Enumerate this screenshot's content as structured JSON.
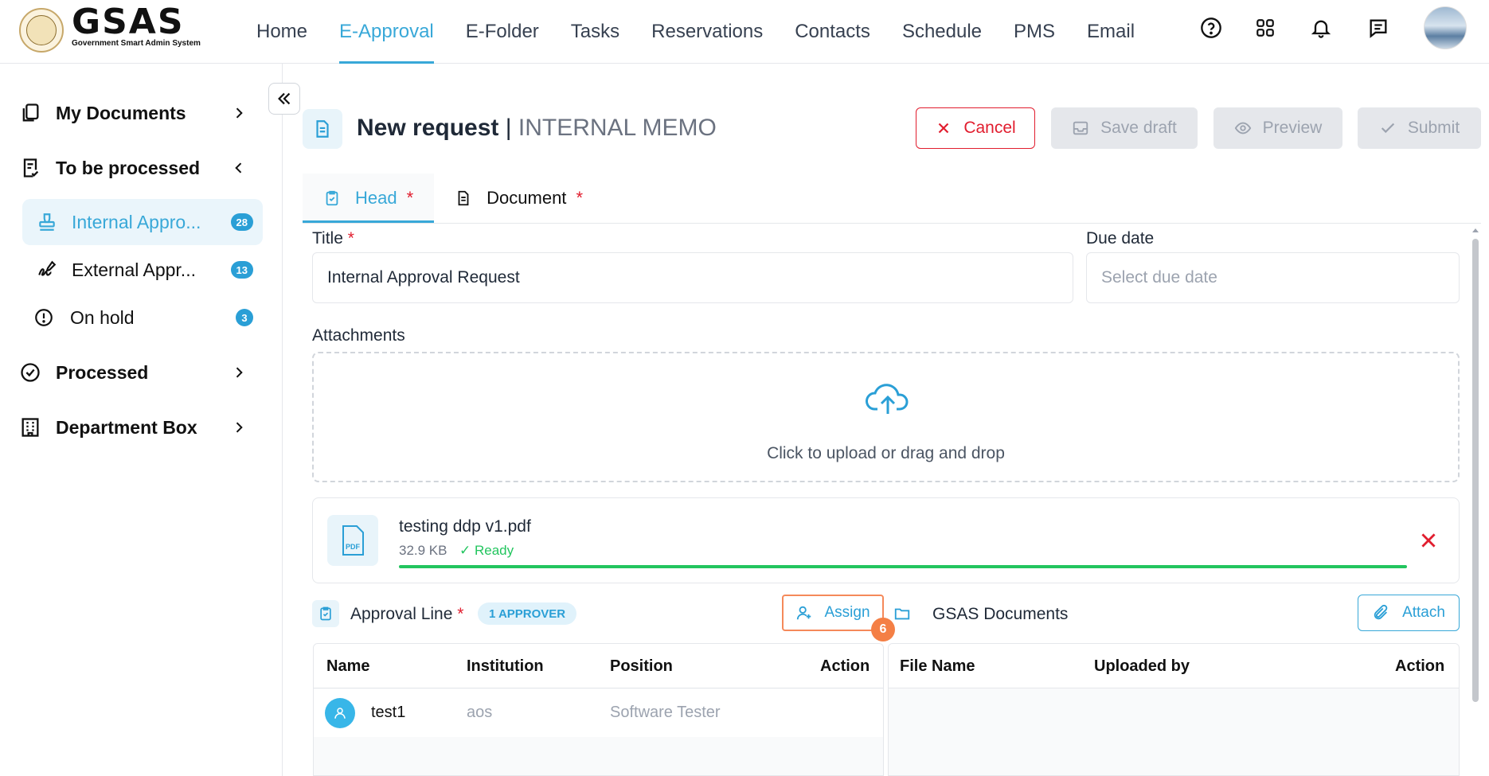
{
  "brand": {
    "name": "GSAS",
    "subtitle": "Government Smart Admin System"
  },
  "nav": {
    "items": [
      {
        "label": "Home",
        "active": false
      },
      {
        "label": "E-Approval",
        "active": true
      },
      {
        "label": "E-Folder",
        "active": false
      },
      {
        "label": "Tasks",
        "active": false
      },
      {
        "label": "Reservations",
        "active": false
      },
      {
        "label": "Contacts",
        "active": false
      },
      {
        "label": "Schedule",
        "active": false
      },
      {
        "label": "PMS",
        "active": false
      },
      {
        "label": "Email",
        "active": false
      }
    ],
    "icons": [
      "help-icon",
      "apps-grid-icon",
      "bell-icon",
      "chat-icon"
    ]
  },
  "sidebar": {
    "my_documents": "My Documents",
    "to_be_processed": "To be processed",
    "sub": [
      {
        "label": "Internal Appro...",
        "count": "28",
        "active": true
      },
      {
        "label": "External Appr...",
        "count": "13",
        "active": false
      },
      {
        "label": "On hold",
        "count": "3",
        "active": false
      }
    ],
    "processed": "Processed",
    "department_box": "Department Box"
  },
  "header": {
    "title": "New request",
    "separator": "|",
    "subtitle": "INTERNAL MEMO",
    "cancel": "Cancel",
    "save_draft": "Save draft",
    "preview": "Preview",
    "submit": "Submit"
  },
  "tabs": [
    {
      "label": "Head",
      "required": "*",
      "active": true
    },
    {
      "label": "Document",
      "required": "*",
      "active": false
    }
  ],
  "form": {
    "title_label": "Title",
    "required_mark": "*",
    "title_value": "Internal Approval Request",
    "due_label": "Due date",
    "due_placeholder": "Select due date",
    "attachments_label": "Attachments",
    "upload_text": "Click to upload or drag and drop"
  },
  "file": {
    "pdf_tag": "PDF",
    "name": "testing ddp v1.pdf",
    "size": "32.9 KB",
    "status": "✓ Ready",
    "progress": 1.0
  },
  "approval": {
    "title": "Approval Line",
    "required_mark": "*",
    "approver_pill": "1 APPROVER",
    "assign": "Assign",
    "step": "6",
    "columns": [
      "Name",
      "Institution",
      "Position",
      "Action"
    ],
    "rows": [
      {
        "name": "test1",
        "institution": "aos",
        "position": "Software Tester"
      }
    ]
  },
  "gsas_docs": {
    "title": "GSAS Documents",
    "attach": "Attach",
    "columns": [
      "File Name",
      "Uploaded by",
      "Action"
    ]
  },
  "colors": {
    "accent": "#38a8d8",
    "danger": "#e11d2e",
    "success": "#22c55e",
    "step": "#f47f45"
  }
}
